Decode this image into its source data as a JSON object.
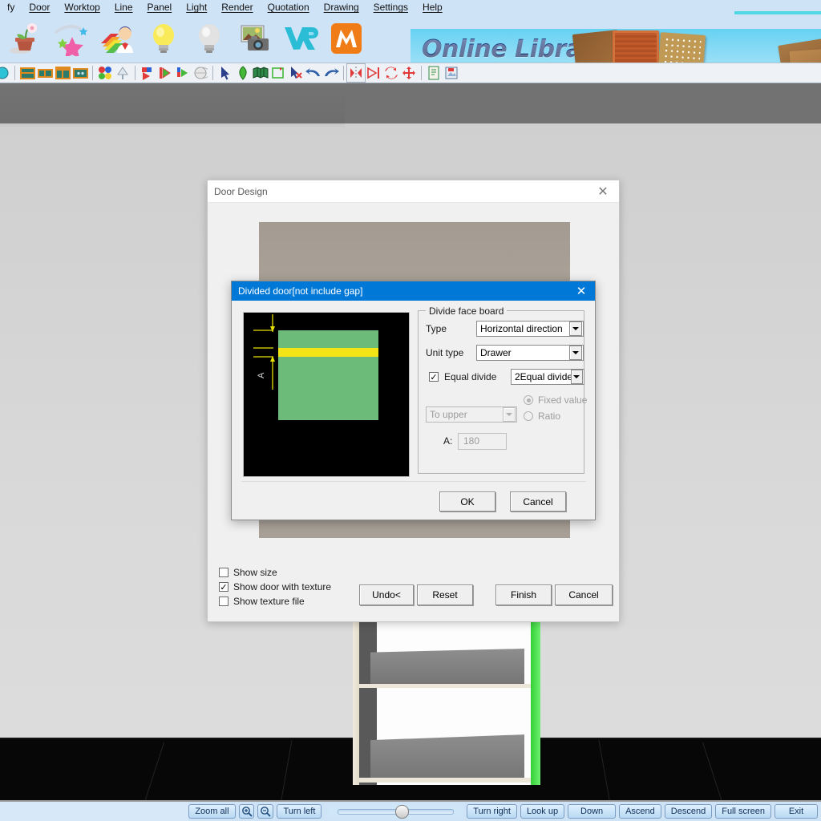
{
  "menubar": {
    "items": [
      {
        "label": "fy",
        "accel": ""
      },
      {
        "label": "Door",
        "accel": "D"
      },
      {
        "label": "Worktop",
        "accel": "W"
      },
      {
        "label": "Line",
        "accel": "L"
      },
      {
        "label": "Panel",
        "accel": "P"
      },
      {
        "label": "Light",
        "accel": "L"
      },
      {
        "label": "Render",
        "accel": "R"
      },
      {
        "label": "Quotation",
        "accel": "Q"
      },
      {
        "label": "Drawing",
        "accel": "D"
      },
      {
        "label": "Settings",
        "accel": "S"
      },
      {
        "label": "Help",
        "accel": "H"
      }
    ]
  },
  "bigtoolbar": {
    "icons": [
      {
        "name": "plant-pot-icon"
      },
      {
        "name": "sparkle-stars-icon"
      },
      {
        "name": "designer-person-icon"
      },
      {
        "name": "light-bulb-on-icon"
      },
      {
        "name": "light-bulb-off-icon"
      },
      {
        "name": "photo-camera-icon"
      },
      {
        "name": "vr-icon"
      },
      {
        "name": "m-logo-icon"
      }
    ]
  },
  "banner": {
    "title": "Online Library"
  },
  "smalltoolbar": {
    "icons": [
      {
        "name": "cabinet-base-icon"
      },
      {
        "name": "cabinet-wall-icon"
      },
      {
        "name": "cabinet-tall-icon"
      },
      {
        "name": "cabinet-corner-icon"
      },
      {
        "name": "color-palette-icon"
      },
      {
        "name": "lamp-icon"
      },
      {
        "name": "paint-flag-icon"
      },
      {
        "name": "play-flag-icon"
      },
      {
        "name": "render-flag-icon"
      },
      {
        "name": "sphere-icon"
      },
      {
        "name": "select-arrow-icon"
      },
      {
        "name": "leaf-icon"
      },
      {
        "name": "book-icon"
      },
      {
        "name": "frame-icon"
      },
      {
        "name": "delete-arrow-icon"
      },
      {
        "name": "undo-icon"
      },
      {
        "name": "redo-icon"
      },
      {
        "name": "mirror-icon"
      },
      {
        "name": "align-icon"
      },
      {
        "name": "rotate-icon"
      },
      {
        "name": "move-icon"
      },
      {
        "name": "document-icon"
      },
      {
        "name": "save-image-icon"
      }
    ]
  },
  "door_dialog": {
    "title": "Door Design",
    "close_label": "✕",
    "checkboxes": [
      {
        "label": "Show size",
        "checked": false
      },
      {
        "label": "Show door with texture",
        "checked": true
      },
      {
        "label": "Show texture file",
        "checked": false
      }
    ],
    "buttons": [
      {
        "label": "Undo<"
      },
      {
        "label": "Reset"
      },
      {
        "label": "Finish"
      },
      {
        "label": "Cancel"
      }
    ]
  },
  "divided_dialog": {
    "title": "Divided door[not include gap]",
    "close_label": "✕",
    "group_label": "Divide face board",
    "fields": {
      "type_label": "Type",
      "type_value": "Horizontal direction",
      "unit_type_label": "Unit type",
      "unit_type_value": "Drawer",
      "equal_divide_label": "Equal divide",
      "equal_divide_checked": true,
      "equal_divide_value": "2Equal divide",
      "direction_value": "To upper",
      "fixed_value_label": "Fixed value",
      "ratio_label": "Ratio",
      "a_label": "A:",
      "a_value": "180"
    },
    "buttons": [
      {
        "label": "OK"
      },
      {
        "label": "Cancel"
      }
    ],
    "preview": {
      "dimension_label": "A"
    }
  },
  "statusbar": {
    "buttons_left": [
      {
        "label": "Zoom all",
        "name": "zoom-all-button"
      },
      {
        "label": "",
        "name": "zoom-in-button"
      },
      {
        "label": "",
        "name": "zoom-out-button"
      },
      {
        "label": "Turn left",
        "name": "turn-left-button"
      }
    ],
    "buttons_right": [
      {
        "label": "Turn right",
        "name": "turn-right-button"
      },
      {
        "label": "Look up",
        "name": "look-up-button"
      },
      {
        "label": "Down",
        "name": "down-button"
      },
      {
        "label": "Ascend",
        "name": "ascend-button"
      },
      {
        "label": "Descend",
        "name": "descend-button"
      },
      {
        "label": "Full screen",
        "name": "full-screen-button"
      },
      {
        "label": "Exit",
        "name": "exit-button"
      }
    ]
  },
  "colors": {
    "menubar_bg": "#cfe3f7",
    "dialog_title_blue": "#0078d7",
    "preview_green": "#6cbb78",
    "preview_yellow": "#f2e416",
    "cabinet_green_edge": "#33d036",
    "banner_sky": "#8fdcf6"
  }
}
